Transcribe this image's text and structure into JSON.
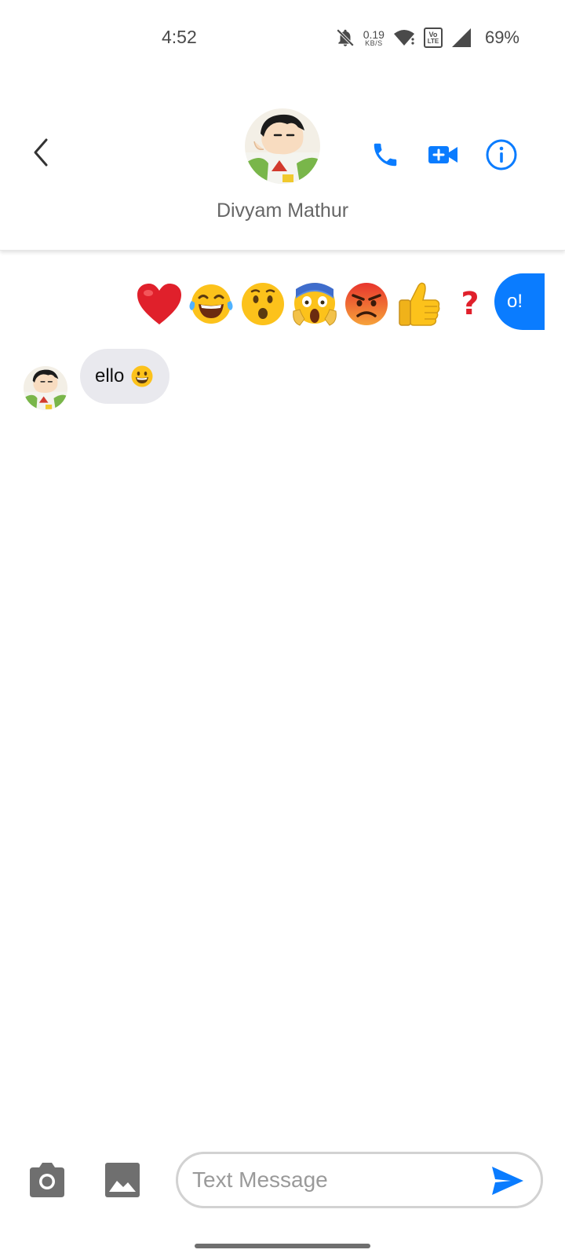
{
  "status_bar": {
    "time": "4:52",
    "net_speed_value": "0.19",
    "net_speed_unit": "KB/S",
    "volte_top": "Vo",
    "volte_bottom": "LTE",
    "battery": "69%",
    "icons": [
      "bell-off-icon",
      "wifi-icon",
      "volte-icon",
      "cell-signal-icon"
    ]
  },
  "header": {
    "contact_name": "Divyam Mathur",
    "back_icon": "chevron-left-icon",
    "actions": [
      "phone-icon",
      "video-call-icon",
      "info-icon"
    ],
    "accent_color": "#0a7cff"
  },
  "messages": {
    "outgoing_partial_text": "o!",
    "incoming_text": "ello",
    "incoming_emoji": "grinning-face",
    "reactions": [
      "heart",
      "laugh-tears",
      "surprised",
      "screaming",
      "angry",
      "thumbs-up",
      "question-mark"
    ],
    "reaction_question_glyph": "?"
  },
  "composer": {
    "placeholder": "Text Message",
    "value": "",
    "icons": [
      "camera-icon",
      "image-gallery-icon",
      "send-icon"
    ]
  }
}
